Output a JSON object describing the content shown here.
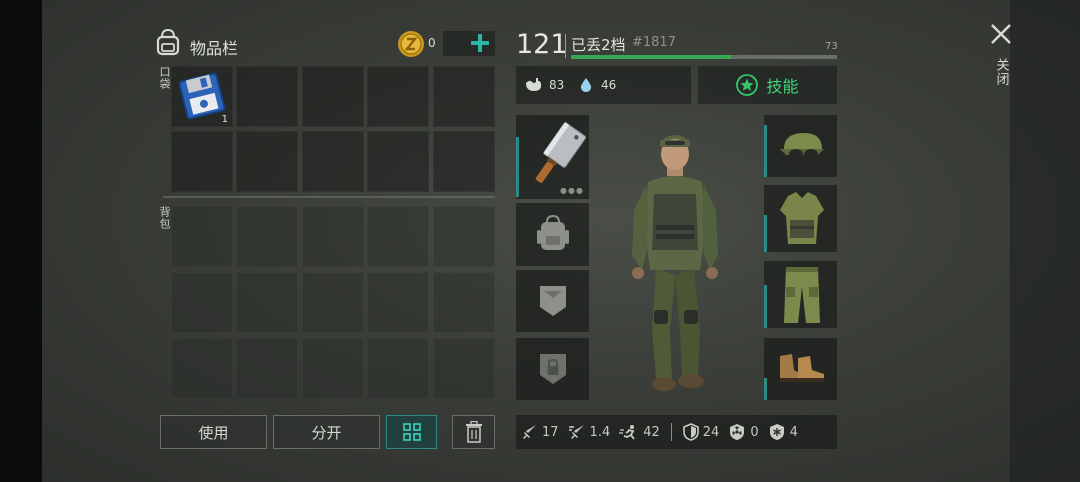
{
  "inventory": {
    "title": "物品栏",
    "coin_count": "0",
    "pocket_label": "口袋",
    "backpack_label": "背包",
    "floppy_count": "1"
  },
  "actions": {
    "use_label": "使用",
    "split_label": "分开"
  },
  "character": {
    "level": "121",
    "status": "已丢2档",
    "id": "#1817",
    "xp_value": "73",
    "xp_fraction": 0.6,
    "hunger": "83",
    "thirst": "46",
    "skills_label": "技能"
  },
  "stats": {
    "attack": "17",
    "attack_speed": "1.4",
    "move_speed": "42",
    "defense": "24",
    "radiation": "0",
    "cold": "4"
  },
  "close": {
    "label": "关闭"
  },
  "colors": {
    "accent_green": "#34a853",
    "teal": "#2a8a86",
    "plus": "#29b5a8"
  }
}
